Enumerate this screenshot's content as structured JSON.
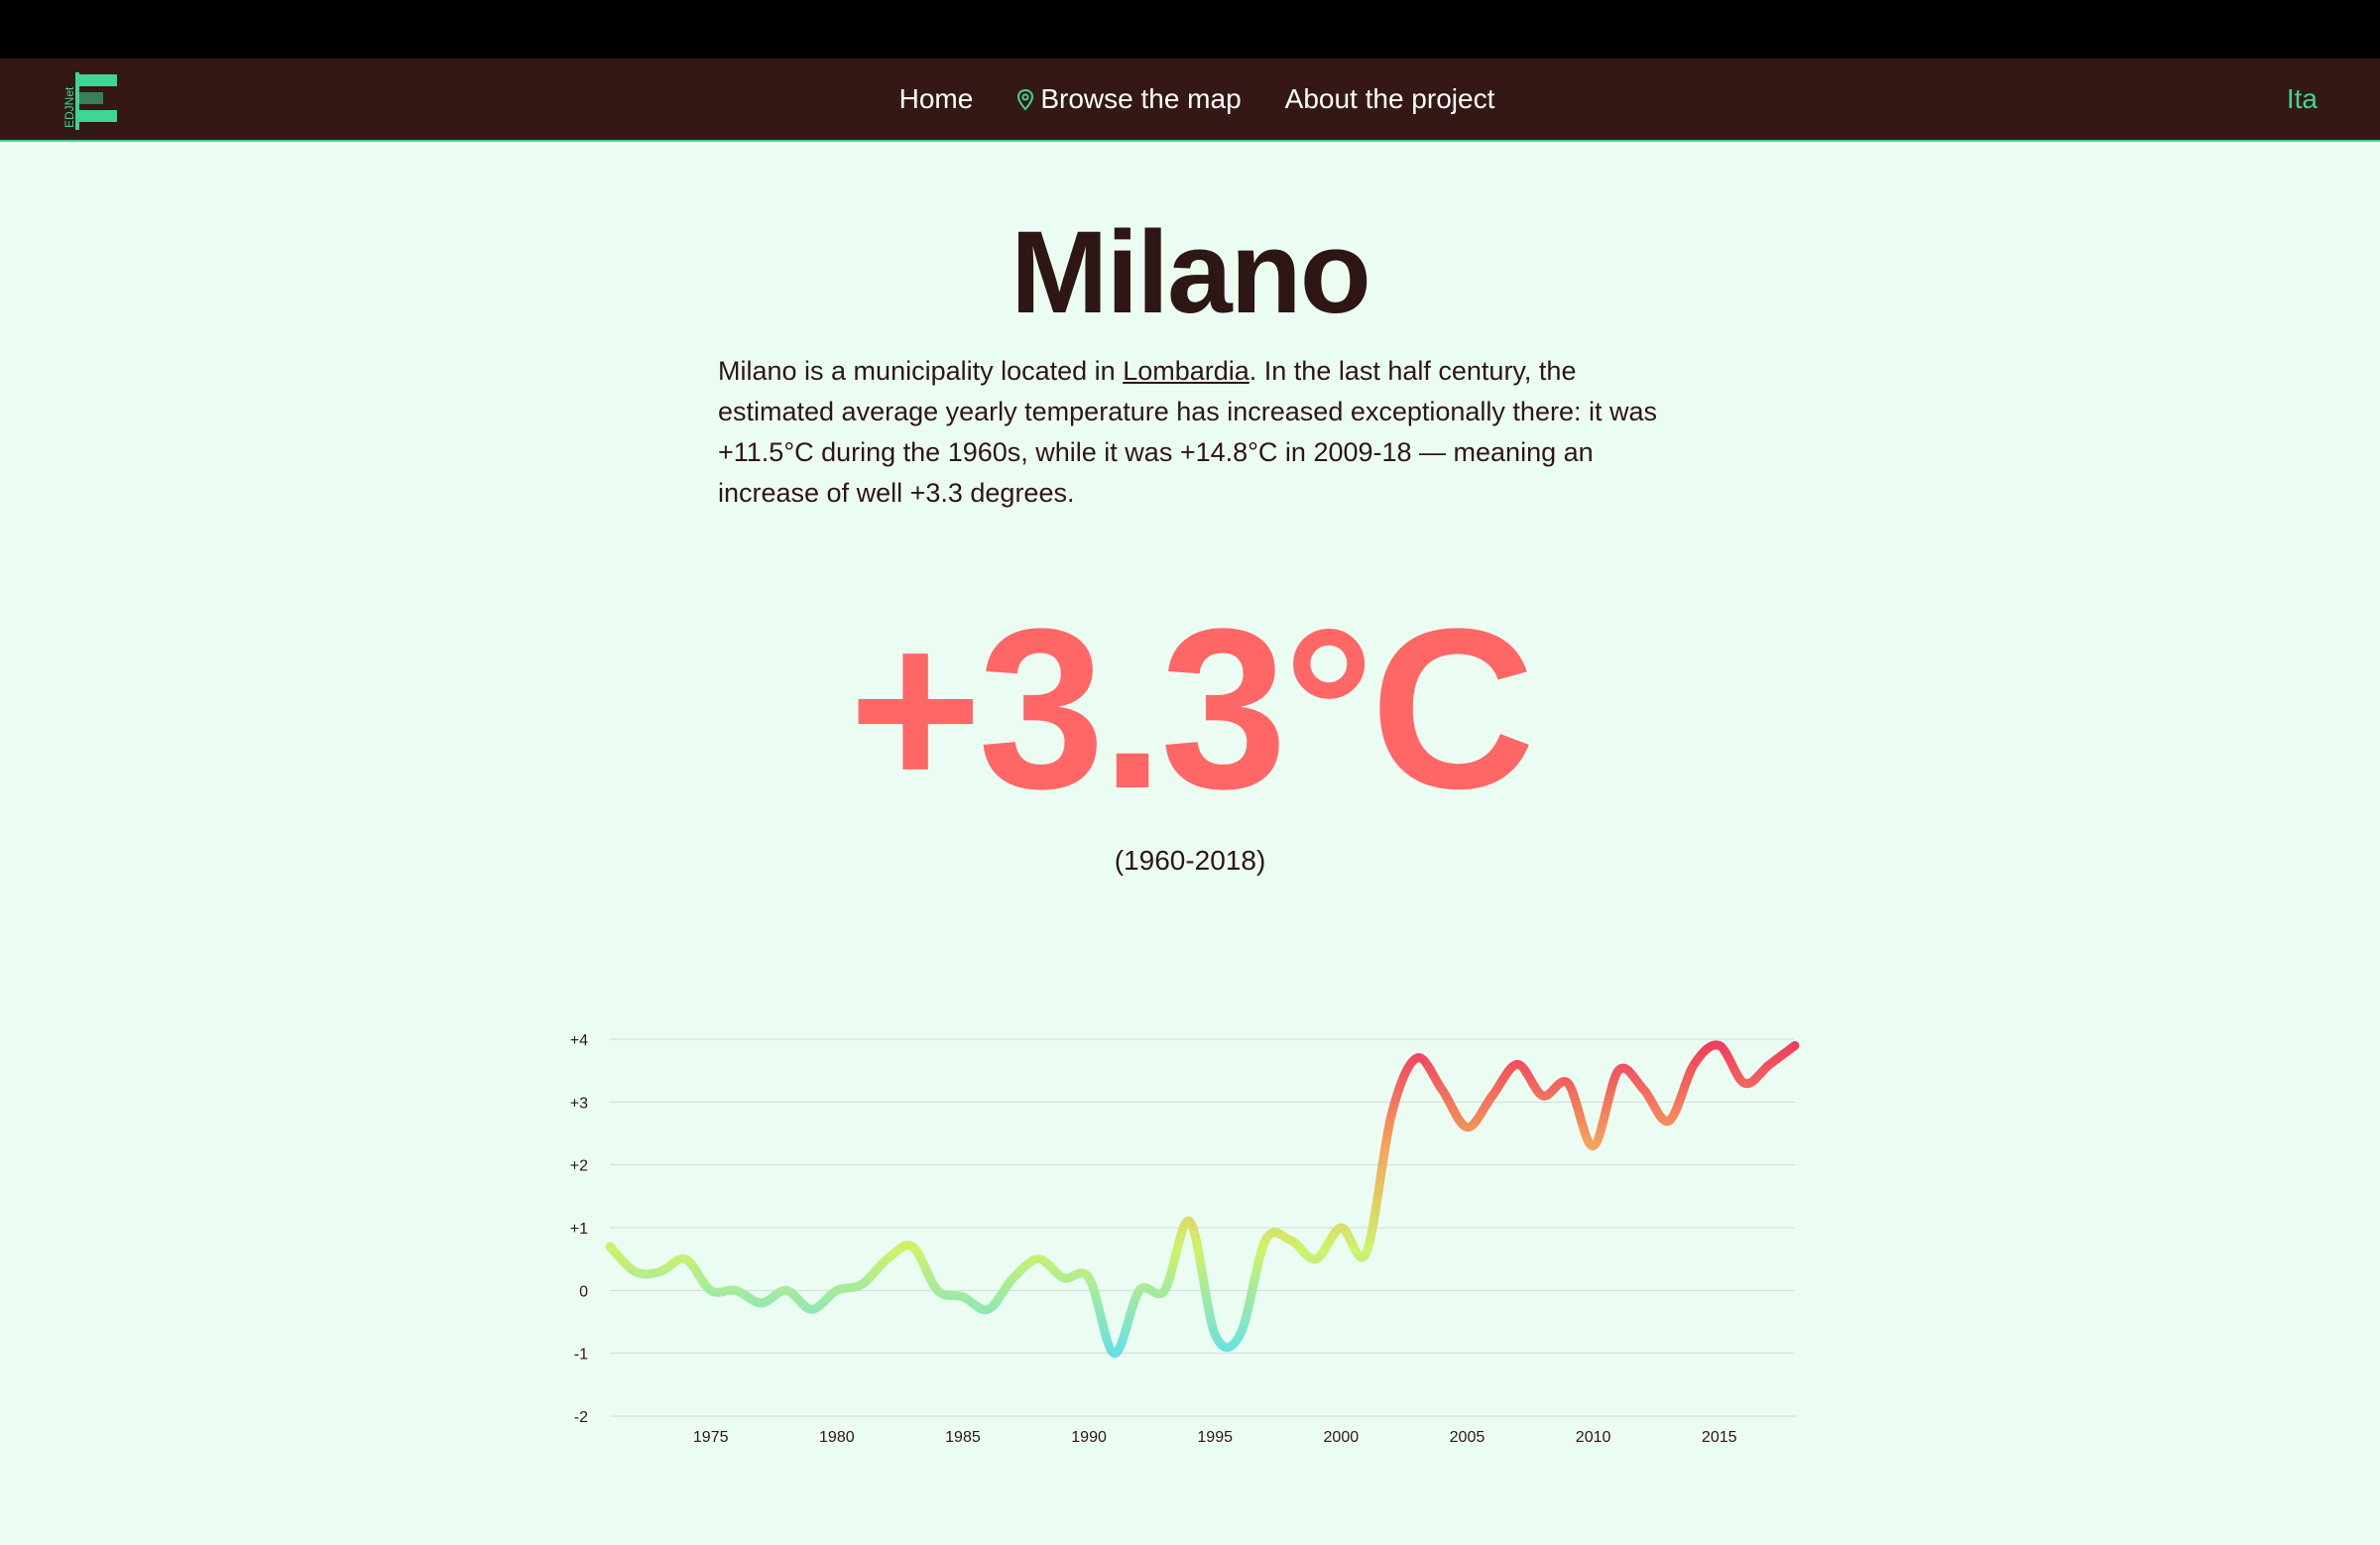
{
  "header": {
    "logo_text": "EDJNet",
    "nav": [
      {
        "label": "Home",
        "icon": ""
      },
      {
        "label": "Browse the map",
        "icon": "map-pin-icon"
      },
      {
        "label": "About the project",
        "icon": ""
      }
    ],
    "language": "Ita"
  },
  "main": {
    "title": "Milano",
    "description": {
      "before_link": "Milano is a municipality located in ",
      "link": "Lombardia",
      "after_link": ". In the last half century, the estimated average yearly temperature has increased exceptionally there: it was +11.5°C during the 1960s, while it was +14.8°C in 2009-18 — meaning an increase of well +3.3 degrees."
    },
    "delta": "+3.3°C",
    "period": "(1960-2018)"
  },
  "colors": {
    "background": "#ebfdf3",
    "nav_background": "#351816",
    "accent_green": "#3ed596",
    "text": "#2e1614",
    "highlight": "#ff6666"
  },
  "chart_data": {
    "type": "line",
    "x": [
      1971,
      1972,
      1973,
      1974,
      1975,
      1976,
      1977,
      1978,
      1979,
      1980,
      1981,
      1982,
      1983,
      1984,
      1985,
      1986,
      1987,
      1988,
      1989,
      1990,
      1991,
      1992,
      1993,
      1994,
      1995,
      1996,
      1997,
      1998,
      1999,
      2000,
      2001,
      2002,
      2003,
      2004,
      2005,
      2006,
      2007,
      2008,
      2009,
      2010,
      2011,
      2012,
      2013,
      2014,
      2015,
      2016,
      2017,
      2018
    ],
    "y": [
      0.7,
      0.3,
      0.3,
      0.5,
      0.0,
      0.0,
      -0.2,
      0.0,
      -0.3,
      0.0,
      0.1,
      0.5,
      0.7,
      0.0,
      -0.1,
      -0.3,
      0.2,
      0.5,
      0.2,
      0.2,
      -1.0,
      0.0,
      0.0,
      1.1,
      -0.7,
      -0.7,
      0.8,
      0.8,
      0.5,
      1.0,
      0.6,
      2.8,
      3.7,
      3.2,
      2.6,
      3.1,
      3.6,
      3.1,
      3.3,
      2.3,
      3.5,
      3.2,
      2.7,
      3.6,
      3.9,
      3.3,
      3.6,
      3.9
    ],
    "xticks": [
      1975,
      1980,
      1985,
      1990,
      1995,
      2000,
      2005,
      2010,
      2015
    ],
    "yticks": [
      "-2",
      "-1",
      "0",
      "+1",
      "+2",
      "+3",
      "+4"
    ],
    "xlim": [
      1971,
      2018
    ],
    "ylim": [
      -2,
      4
    ],
    "grid": true,
    "color_scale": [
      "#66e0e6",
      "#cff26a",
      "#f5a35c",
      "#f2365e"
    ]
  }
}
